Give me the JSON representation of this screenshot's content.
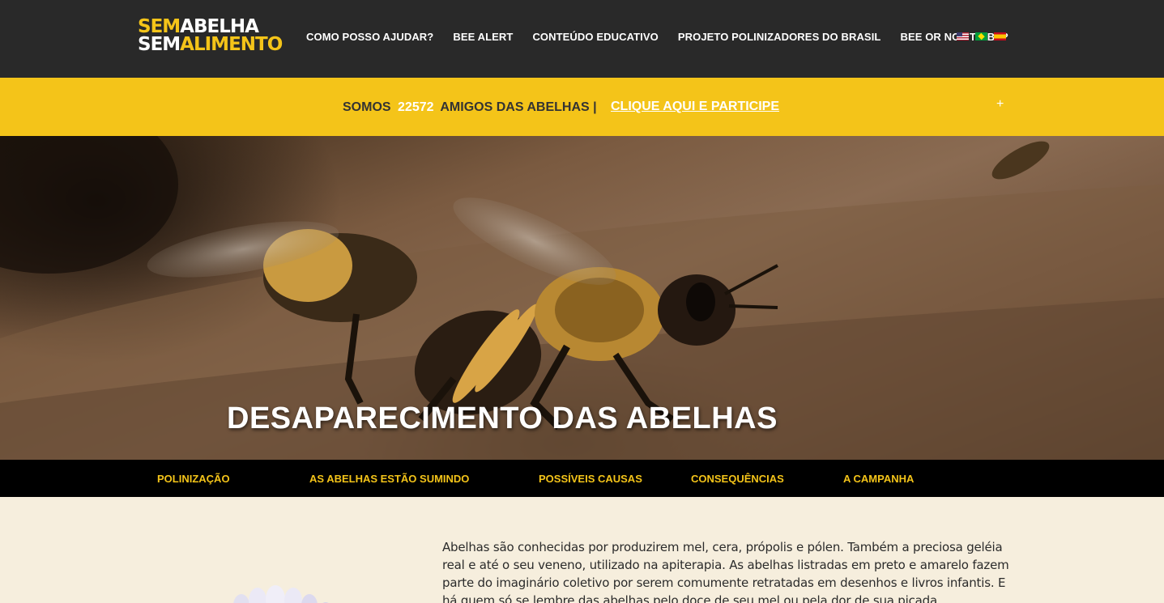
{
  "logo": {
    "line1_a": "SEM",
    "line1_b": "ABELHA",
    "line2_a": "SEM",
    "line2_b": "ALIMENTO"
  },
  "topnav": {
    "items": [
      {
        "label": "COMO POSSO AJUDAR?"
      },
      {
        "label": "BEE ALERT"
      },
      {
        "label": "CONTEÚDO EDUCATIVO"
      },
      {
        "label": "PROJETO POLINIZADORES DO BRASIL"
      },
      {
        "label": "BEE OR NOT TO BE?"
      }
    ],
    "flags": [
      "us-flag-icon",
      "brazil-flag-icon",
      "spain-flag-icon"
    ]
  },
  "banner": {
    "prefix": "SOMOS",
    "count": "22572",
    "suffix": "AMIGOS DAS ABELHAS |",
    "cta": "CLIQUE AQUI E PARTICIPE",
    "toggle": "+"
  },
  "hero": {
    "title": "DESAPARECIMENTO DAS ABELHAS"
  },
  "subnav": {
    "items": [
      {
        "label": "POLINIZAÇÃO"
      },
      {
        "label": "AS ABELHAS ESTÃO SUMINDO"
      },
      {
        "label": "POSSÍVEIS CAUSAS"
      },
      {
        "label": "CONSEQUÊNCIAS"
      },
      {
        "label": "A CAMPANHA"
      }
    ]
  },
  "content": {
    "paragraph": "Abelhas são conhecidas por produzirem mel, cera, própolis e pólen. Também a preciosa geléia real e até o seu veneno, utilizado na apiterapia. As abelhas listradas em preto e amarelo fazem parte do imaginário coletivo por serem comumente retratadas em desenhos e livros infantis. E há quem só se lembre das abelhas pelo doce de seu mel ou pela dor de sua picada."
  },
  "colors": {
    "accent": "#f4c419",
    "topnav_bg": "#292929",
    "subnav_bg": "#000000",
    "page_bg": "#f6eedd"
  }
}
